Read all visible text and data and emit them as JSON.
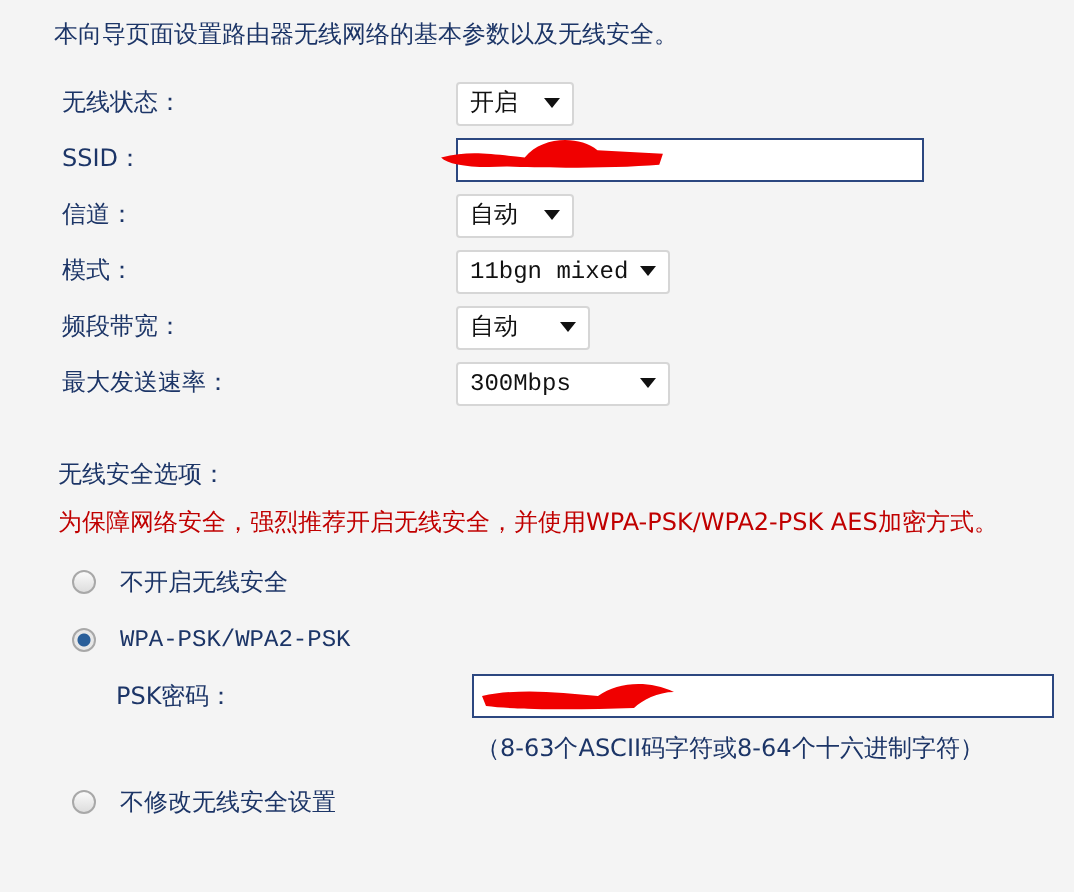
{
  "intro": "本向导页面设置路由器无线网络的基本参数以及无线安全。",
  "settings": [
    {
      "label": "无线状态：",
      "kind": "select",
      "value": "开启"
    },
    {
      "label": "SSID：",
      "kind": "input",
      "redacted": true
    },
    {
      "label": "信道：",
      "kind": "select",
      "value": "自动"
    },
    {
      "label": "模式：",
      "kind": "select",
      "value": "11bgn mixed"
    },
    {
      "label": "频段带宽：",
      "kind": "select",
      "value": "自动"
    },
    {
      "label": "最大发送速率：",
      "kind": "select",
      "value": "300Mbps"
    }
  ],
  "security": {
    "title": "无线安全选项：",
    "warning": "为保障网络安全，强烈推荐开启无线安全，并使用WPA-PSK/WPA2-PSK AES加密方式。",
    "options": [
      {
        "label": "不开启无线安全",
        "selected": false
      },
      {
        "label": "WPA-PSK/WPA2-PSK",
        "selected": true,
        "psk": {
          "label": "PSK密码：",
          "redacted": true,
          "hint": "（8-63个ASCII码字符或8-64个十六进制字符）"
        }
      },
      {
        "label": "不修改无线安全设置",
        "selected": false
      }
    ]
  }
}
